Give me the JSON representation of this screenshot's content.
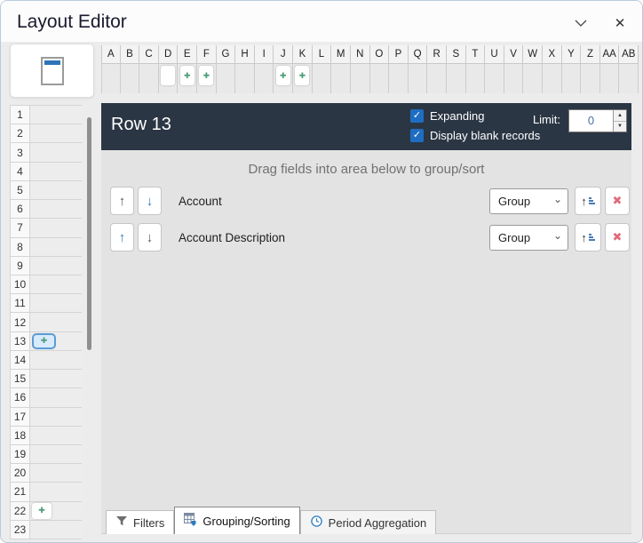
{
  "window": {
    "title": "Layout Editor"
  },
  "icons": {
    "check": "✓",
    "plus": "✚",
    "close": "✕",
    "select_chevron": "⌄",
    "up_arrow": "↑",
    "down_arrow": "↓",
    "delete_x": "✖",
    "spin_up": "▲",
    "spin_down": "▼"
  },
  "grid": {
    "columns": [
      "A",
      "B",
      "C",
      "D",
      "E",
      "F",
      "G",
      "H",
      "I",
      "J",
      "K",
      "L",
      "M",
      "N",
      "O",
      "P",
      "Q",
      "R",
      "S",
      "T",
      "U",
      "V",
      "W",
      "X",
      "Y",
      "Z",
      "AA",
      "AB"
    ],
    "column_cells": [
      {
        "column": "D",
        "plus": false
      },
      {
        "column": "E",
        "plus": true
      },
      {
        "column": "F",
        "plus": true
      },
      {
        "column": "J",
        "plus": true
      },
      {
        "column": "K",
        "plus": true
      }
    ],
    "rows": [
      1,
      2,
      3,
      4,
      5,
      6,
      7,
      8,
      9,
      10,
      11,
      12,
      13,
      14,
      15,
      16,
      17,
      18,
      19,
      20,
      21,
      22,
      23
    ],
    "selected_row": 13,
    "plus_rows": [
      13,
      22
    ]
  },
  "row_editor": {
    "title": "Row 13",
    "expanding": {
      "label": "Expanding",
      "checked": true
    },
    "display_blank": {
      "label": "Display blank records",
      "checked": true
    },
    "limit_label": "Limit:",
    "limit_value": "0"
  },
  "grouping": {
    "drag_hint": "Drag fields into area below to group/sort",
    "fields": [
      {
        "name": "Account",
        "mode": "Group",
        "up_enabled": false,
        "down_enabled": true
      },
      {
        "name": "Account Description",
        "mode": "Group",
        "up_enabled": true,
        "down_enabled": false
      }
    ]
  },
  "tabs": [
    {
      "label": "Filters",
      "icon": "filter-icon",
      "active": false
    },
    {
      "label": "Grouping/Sorting",
      "icon": "grouping-icon",
      "active": true
    },
    {
      "label": "Period Aggregation",
      "icon": "clock-icon",
      "active": false
    }
  ],
  "colors": {
    "accent_blue": "#1f6dc2",
    "arrow_blue": "#2e7bc0",
    "header_bg": "#2b3644",
    "delete_red": "#e06b7a",
    "field_green": "#4d9b77",
    "selected_cell_border": "#5b9bd5"
  }
}
